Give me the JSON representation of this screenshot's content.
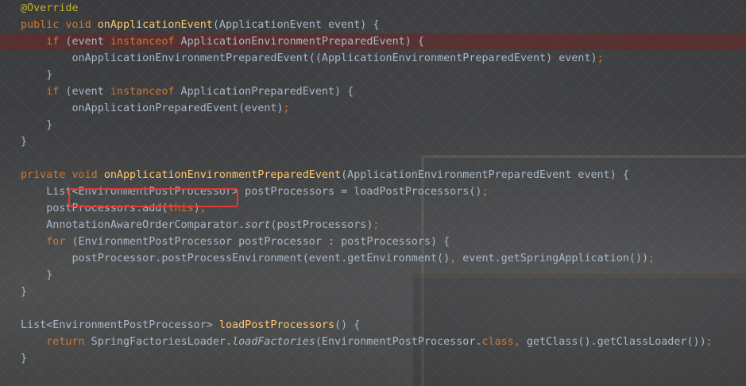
{
  "code_lines": [
    {
      "t0": "@Override"
    },
    {
      "t0": "public void",
      "t1": " ",
      "t2": "onApplicationEvent",
      "t3": "(ApplicationEvent event) {"
    },
    {
      "t0": "    ",
      "t1": "if",
      "t2": " (event ",
      "t3": "instanceof",
      "t4": " ApplicationEnvironmentPreparedEvent) {"
    },
    {
      "t0": "        onApplicationEnvironmentPreparedEvent((ApplicationEnvironmentPreparedEvent) event)",
      "t1": ";"
    },
    {
      "t0": "    }"
    },
    {
      "t0": "    ",
      "t1": "if",
      "t2": " (event ",
      "t3": "instanceof",
      "t4": " ApplicationPreparedEvent) {"
    },
    {
      "t0": "        onApplicationPreparedEvent(event)",
      "t1": ";"
    },
    {
      "t0": "    }"
    },
    {
      "t0": "}"
    },
    {
      "t0": ""
    },
    {
      "t0": "private void",
      "t1": " ",
      "t2": "onApplicationEnvironmentPreparedEvent",
      "t3": "(ApplicationEnvironmentPreparedEvent event) {"
    },
    {
      "t0": "    List<EnvironmentPostProcessor> postProcessors = loadPostProcessors()",
      "t1": ";"
    },
    {
      "t0": "    postProcessors.add(",
      "t1": "this",
      "t2": ")",
      "t3": ";"
    },
    {
      "t0": "    AnnotationAwareOrderComparator.",
      "t1": "sort",
      "t2": "(postProcessors)",
      "t3": ";"
    },
    {
      "t0": "    ",
      "t1": "for",
      "t2": " (EnvironmentPostProcessor postProcessor : postProcessors) {"
    },
    {
      "t0": "        postProcessor.postProcessEnvironment(event.getEnvironment()",
      "t1": ", ",
      "t2": "event.getSpringApplication())",
      "t3": ";"
    },
    {
      "t0": "    }"
    },
    {
      "t0": "}"
    },
    {
      "t0": ""
    },
    {
      "t0": "List<EnvironmentPostProcessor> ",
      "t1": "loadPostProcessors",
      "t2": "() {"
    },
    {
      "t0": "    ",
      "t1": "return",
      "t2": " SpringFactoriesLoader.",
      "t3": "loadFactories",
      "t4": "(EnvironmentPostProcessor.",
      "t5": "class",
      "t6": ", ",
      "t7": "getClass().getClassLoader())",
      "t8": ";"
    },
    {
      "t0": "}"
    }
  ],
  "colors": {
    "keyword": "#cc7832",
    "method_declaration": "#ffc66d",
    "annotation": "#bbb529",
    "default_text": "#a9b7c6",
    "highlight_line": "#692828",
    "annotation_box": "#e53935"
  }
}
